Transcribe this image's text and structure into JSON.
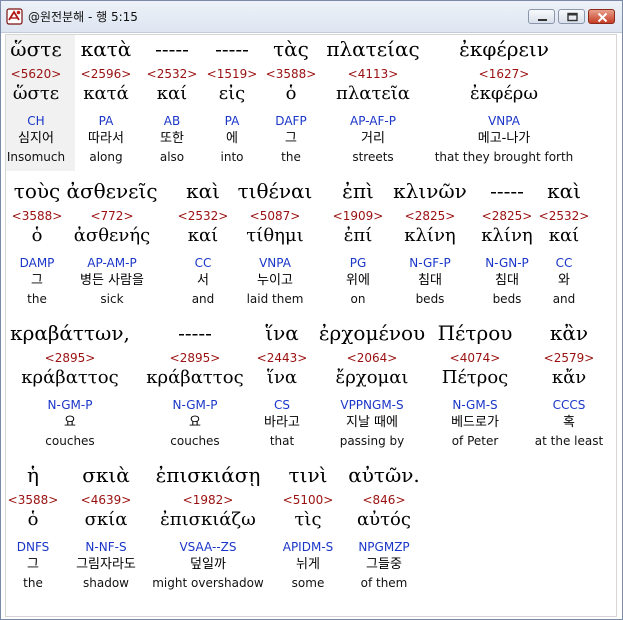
{
  "window": {
    "title": "@원전분해 - 행 5:15"
  },
  "rows": [
    {
      "words": [
        {
          "g": "ὥστε",
          "s": "<5620>",
          "l": "ὥστε",
          "p": "CH",
          "k": "심지어",
          "e": "Insomuch"
        },
        {
          "g": "κατὰ",
          "s": "<2596>",
          "l": "κατά",
          "p": "PA",
          "k": "따라서",
          "e": "along"
        },
        {
          "g": "-----",
          "s": "<2532>",
          "l": "καί",
          "p": "AB",
          "k": "또한",
          "e": "also"
        },
        {
          "g": "-----",
          "s": "<1519>",
          "l": "εἰς",
          "p": "PA",
          "k": "에",
          "e": "into"
        },
        {
          "g": "τὰς",
          "s": "<3588>",
          "l": "ὁ",
          "p": "DAFP",
          "k": "그",
          "e": "the"
        },
        {
          "g": "πλατείας",
          "s": "<4113>",
          "l": "πλατεῖα",
          "p": "AP-AF-P",
          "k": "거리",
          "e": "streets"
        },
        {
          "g": "ἐκφέρειν",
          "s": "<1627>",
          "l": "ἐκφέρω",
          "p": "VNPA",
          "k": "메고-나가",
          "e": "that they brought forth"
        }
      ]
    },
    {
      "words": [
        {
          "g": "τοὺς",
          "s": "<3588>",
          "l": "ὁ",
          "p": "DAMP",
          "k": "그",
          "e": "the"
        },
        {
          "g": "ἀσθενεῖς",
          "s": "<772>",
          "l": "ἀσθενής",
          "p": "AP-AM-P",
          "k": "병든 사람을",
          "e": "sick"
        },
        {
          "g": "καὶ",
          "s": "<2532>",
          "l": "καί",
          "p": "CC",
          "k": "서",
          "e": "and"
        },
        {
          "g": "τιθέναι",
          "s": "<5087>",
          "l": "τίθημι",
          "p": "VNPA",
          "k": "누이고",
          "e": "laid them"
        },
        {
          "g": "ἐπὶ",
          "s": "<1909>",
          "l": "ἐπί",
          "p": "PG",
          "k": "위에",
          "e": "on"
        },
        {
          "g": "κλινῶν",
          "s": "<2825>",
          "l": "κλίνη",
          "p": "N-GF-P",
          "k": "침대",
          "e": "beds"
        },
        {
          "g": "-----",
          "s": "<2825>",
          "l": "κλίνη",
          "p": "N-GN-P",
          "k": "침대",
          "e": "beds"
        },
        {
          "g": "καὶ",
          "s": "<2532>",
          "l": "καί",
          "p": "CC",
          "k": "와",
          "e": "and"
        }
      ]
    },
    {
      "words": [
        {
          "g": "κραβάττων,",
          "s": "<2895>",
          "l": "κράβαττος",
          "p": "N-GM-P",
          "k": "요",
          "e": "couches"
        },
        {
          "g": "-----",
          "s": "<2895>",
          "l": "κράβαττος",
          "p": "N-GM-P",
          "k": "요",
          "e": "couches"
        },
        {
          "g": "ἵνα",
          "s": "<2443>",
          "l": "ἵνα",
          "p": "CS",
          "k": "바라고",
          "e": "that"
        },
        {
          "g": "ἐρχομένου",
          "s": "<2064>",
          "l": "ἔρχομαι",
          "p": "VPPNGM-S",
          "k": "지날 때에",
          "e": "passing by"
        },
        {
          "g": "Πέτρου",
          "s": "<4074>",
          "l": "Πέτρος",
          "p": "N-GM-S",
          "k": "베드로가",
          "e": "of Peter"
        },
        {
          "g": "κἂν",
          "s": "<2579>",
          "l": "κἄν",
          "p": "CCCS",
          "k": "혹",
          "e": "at the least"
        }
      ]
    },
    {
      "words": [
        {
          "g": "ἡ",
          "s": "<3588>",
          "l": "ὁ",
          "p": "DNFS",
          "k": "그",
          "e": "the"
        },
        {
          "g": "σκιὰ",
          "s": "<4639>",
          "l": "σκία",
          "p": "N-NF-S",
          "k": "그림자라도",
          "e": "shadow"
        },
        {
          "g": "ἐπισκιάσῃ",
          "s": "<1982>",
          "l": "ἐπισκιάζω",
          "p": "VSAA--ZS",
          "k": "덮일까",
          "e": "might overshadow"
        },
        {
          "g": "τινὶ",
          "s": "<5100>",
          "l": "τὶς",
          "p": "APIDM-S",
          "k": "뉘게",
          "e": "some"
        },
        {
          "g": "αὐτῶν.",
          "s": "<846>",
          "l": "αὐτός",
          "p": "NPGMZP",
          "k": "그들중",
          "e": "of them"
        }
      ]
    }
  ]
}
